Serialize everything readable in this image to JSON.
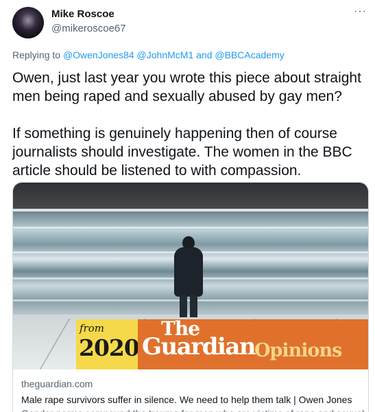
{
  "author": {
    "display_name": "Mike Roscoe",
    "handle": "@mikeroscoe67"
  },
  "menu": {
    "more_label": "···"
  },
  "reply": {
    "prefix": "Replying to",
    "mentions": [
      "@OwenJones84",
      "@JohnMcM1"
    ],
    "and_word": "and",
    "last_mention": "@BBCAcademy"
  },
  "tweet": {
    "paragraph1": "Owen, just last year you wrote this piece about straight men being raped and sexually abused by gay men?",
    "paragraph2": "If something is genuinely happening then of course journalists should investigate. The women in the BBC article should be listened to with compassion."
  },
  "card": {
    "image": {
      "banner_from": "from",
      "banner_year": "2020",
      "banner_the": "The",
      "banner_guardian": "Guardian",
      "banner_opinions": "Opinions",
      "banner_colors": {
        "left": "#f5d94a",
        "right": "#e0712c"
      }
    },
    "domain": "theguardian.com",
    "title": "Male rape survivors suffer in silence. We need to help them talk | Owen Jones",
    "description": "Gender norms compound the trauma for men who are victims of rape and sexual"
  },
  "colors": {
    "link": "#1d9bf0",
    "muted": "#536471",
    "text": "#0f1419"
  }
}
